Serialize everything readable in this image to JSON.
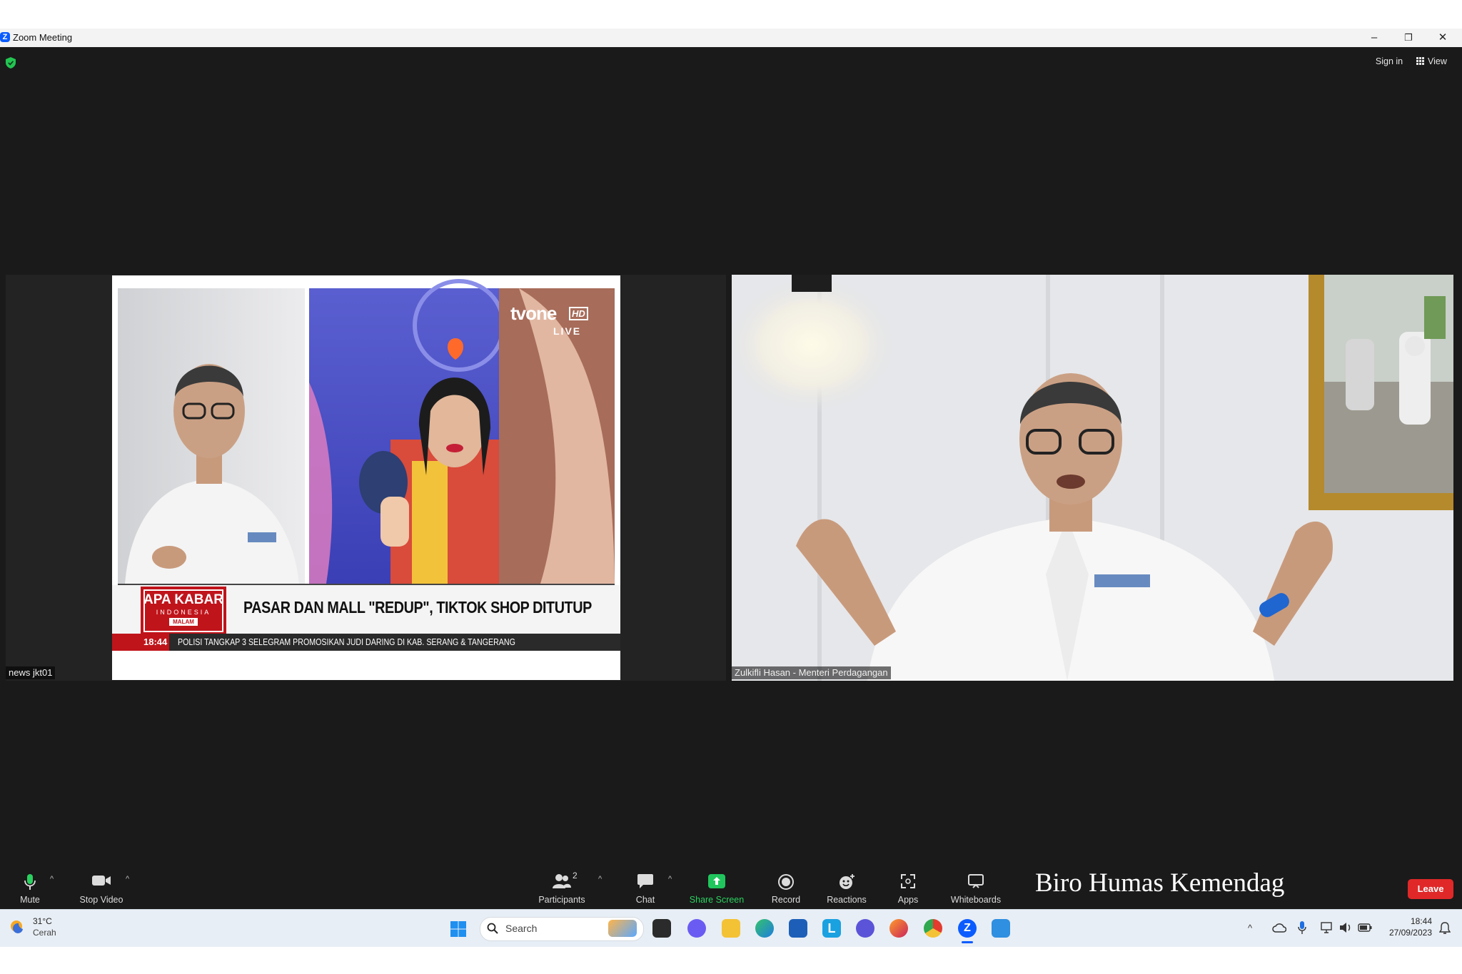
{
  "window": {
    "title": "Zoom Meeting",
    "controls": [
      "–",
      "❐",
      "✕"
    ]
  },
  "topbar": {
    "sign_in": "Sign in",
    "view": "View"
  },
  "tiles": [
    {
      "name": "news jkt01",
      "broadcast": {
        "channel": "tvone",
        "channel_hd": "HD",
        "live": "LIVE",
        "program_line1": "APA KABAR",
        "program_line2": "INDONESIA",
        "program_line3": "MALAM",
        "headline": "PASAR DAN MALL \"REDUP\", TIKTOK SHOP DITUTUP",
        "time": "18:44",
        "ticker": "POLISI TANGKAP 3 SELEGRAM PROMOSIKAN JUDI DARING DI KAB. SERANG & TANGERANG"
      }
    },
    {
      "name": "Zulkifli Hasan - Menteri Perdagangan"
    }
  ],
  "toolbar": {
    "mute": "Mute",
    "stop_video": "Stop Video",
    "participants": "Participants",
    "participants_count": "2",
    "chat": "Chat",
    "share_screen": "Share Screen",
    "record": "Record",
    "reactions": "Reactions",
    "apps": "Apps",
    "whiteboards": "Whiteboards",
    "leave": "Leave"
  },
  "watermark": "Biro Humas Kemendag",
  "taskbar": {
    "weather_temp": "31°C",
    "weather_desc": "Cerah",
    "search_placeholder": "Search",
    "time": "18:44",
    "date": "27/09/2023"
  },
  "colors": {
    "meeting_bg": "#1a1a1a",
    "share_green": "#21c55d",
    "leave_red": "#e02828",
    "zoom_blue": "#0b5cff",
    "news_red": "#c0141b"
  }
}
